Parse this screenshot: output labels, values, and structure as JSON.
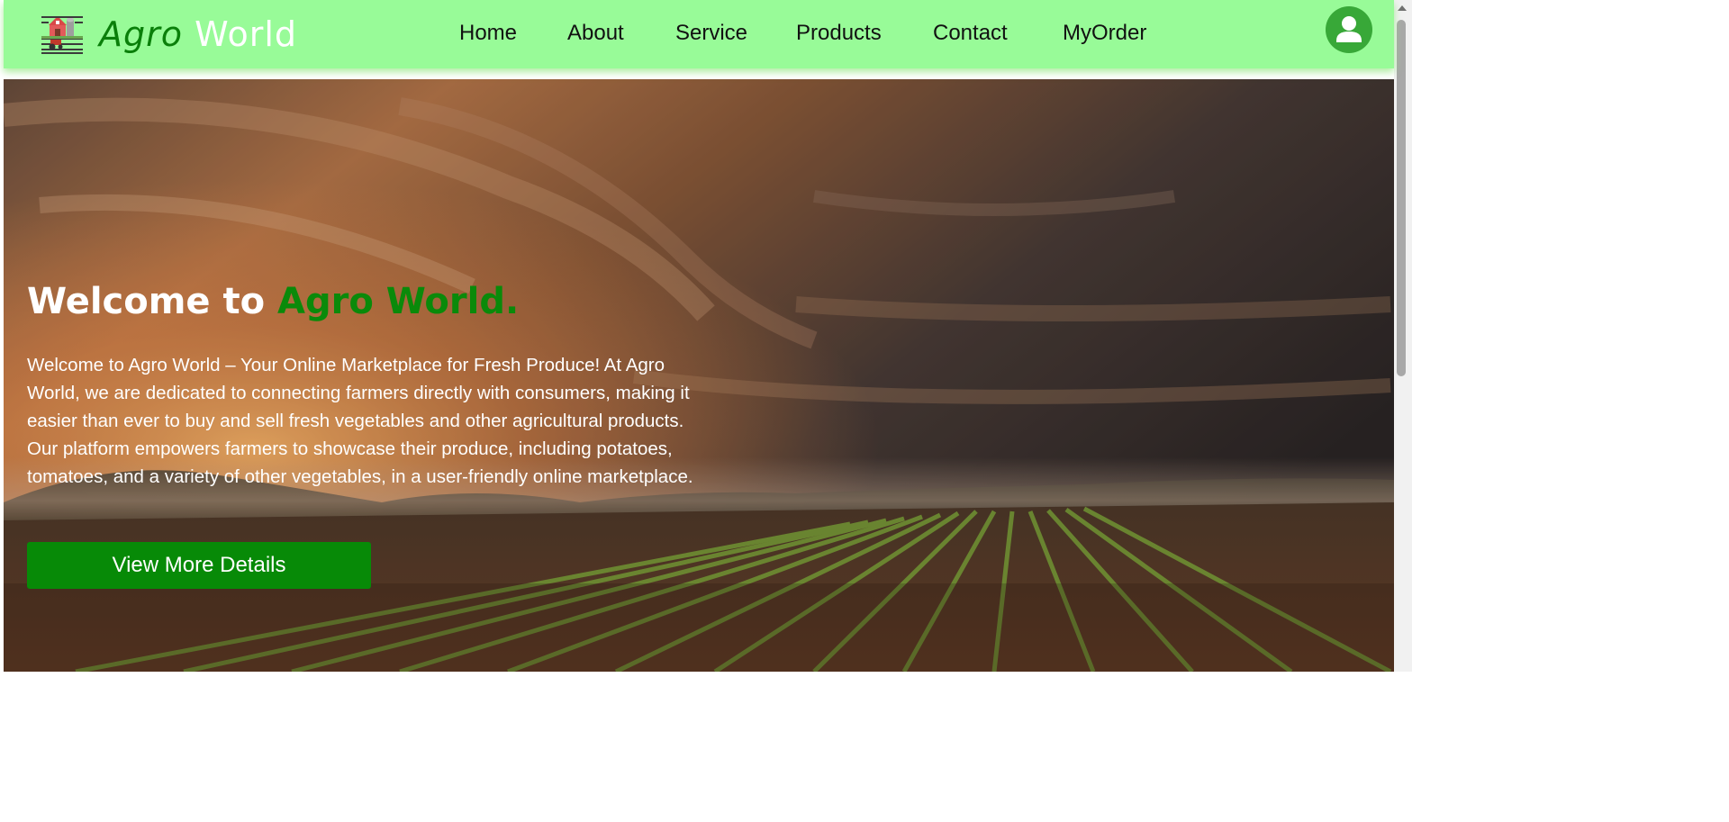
{
  "header": {
    "brand_part1": "Agro",
    "brand_part2": "World",
    "logo_icon": "farm-barn-tractor-icon",
    "avatar_icon": "user-avatar-icon",
    "nav": [
      {
        "label": "Home"
      },
      {
        "label": "About"
      },
      {
        "label": "Service"
      },
      {
        "label": "Products"
      },
      {
        "label": "Contact"
      },
      {
        "label": "MyOrder"
      }
    ],
    "background_color": "#98fb98"
  },
  "hero": {
    "title_prefix": "Welcome to ",
    "title_accent": "Agro World.",
    "description": "Welcome to Agro World – Your Online Marketplace for Fresh Produce! At Agro World, we are dedicated to connecting farmers directly with consumers, making it easier than ever to buy and sell fresh vegetables and other agricultural products. Our platform empowers farmers to showcase their produce, including potatoes, tomatoes, and a variety of other vegetables, in a user-friendly online marketplace.",
    "cta_label": "View More Details",
    "accent_color": "#0a8a0a",
    "cta_color": "#078a07"
  }
}
